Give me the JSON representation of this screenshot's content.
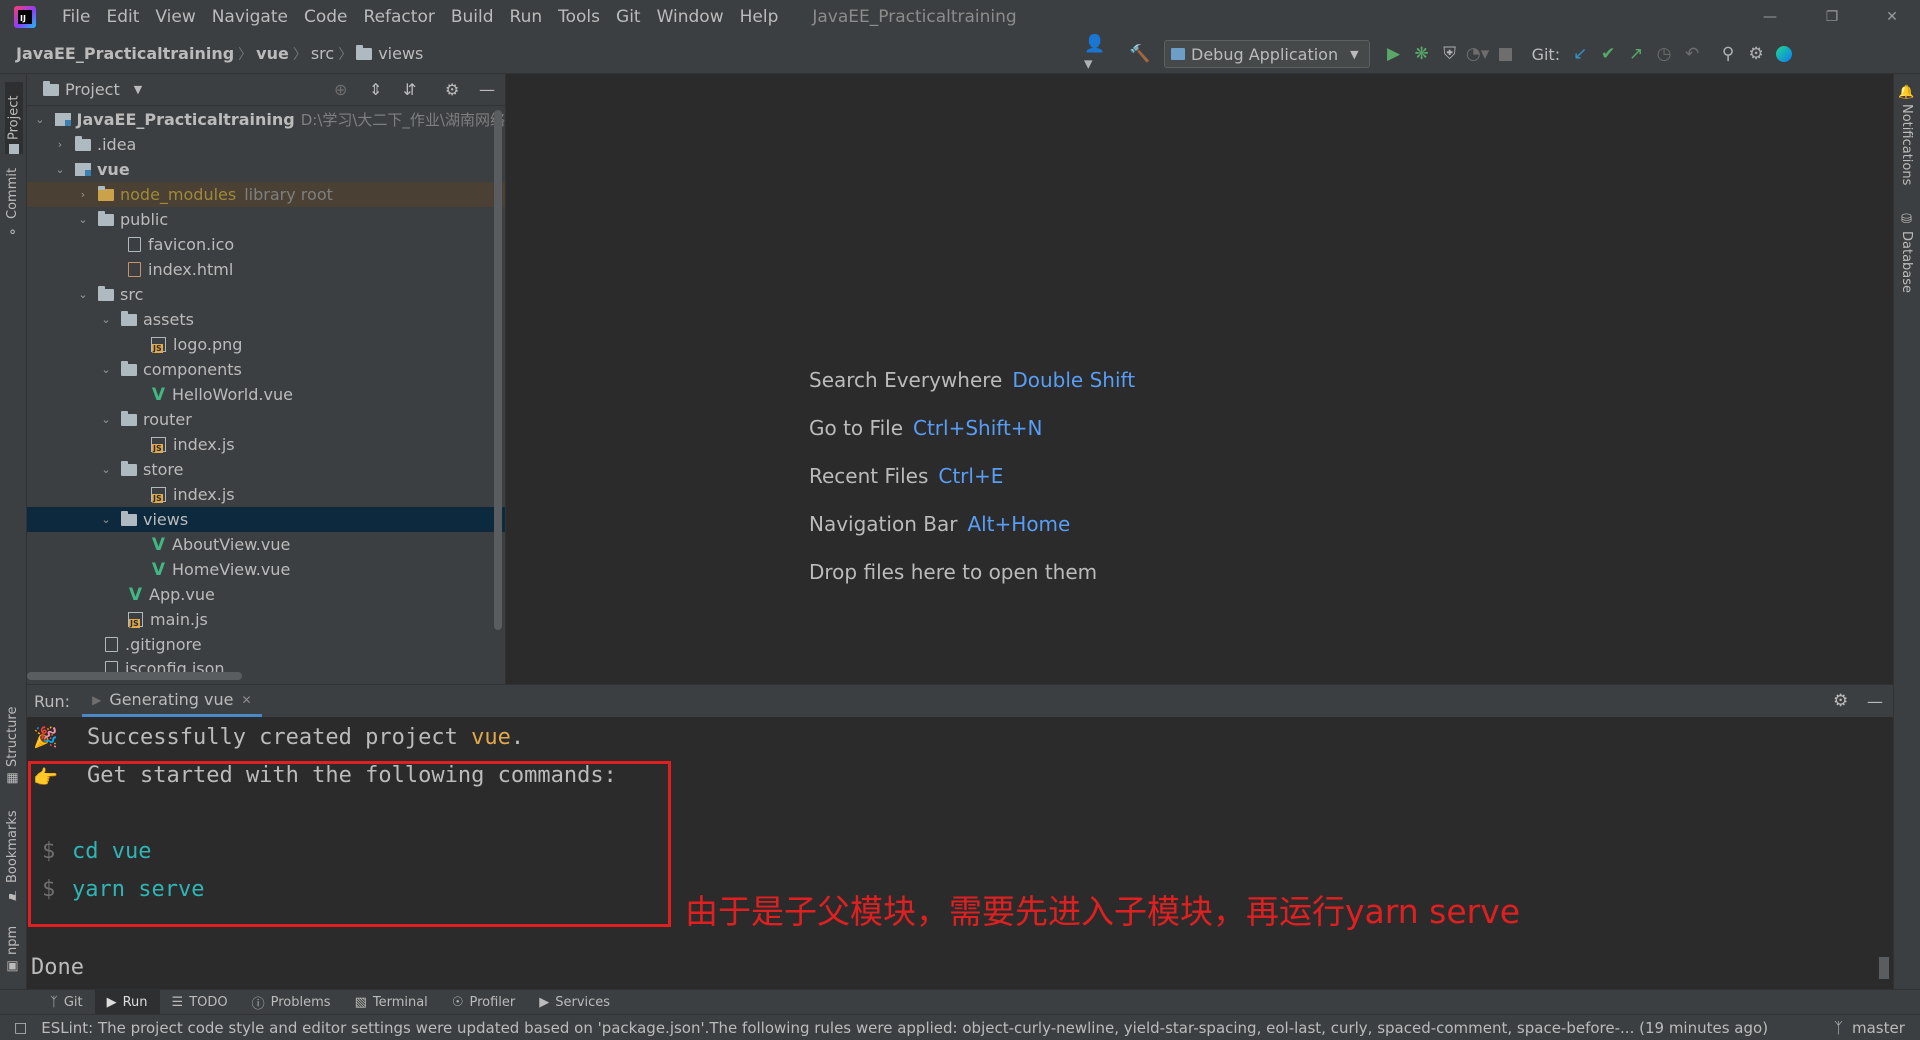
{
  "titlebar": {
    "menus": [
      "File",
      "Edit",
      "View",
      "Navigate",
      "Code",
      "Refactor",
      "Build",
      "Run",
      "Tools",
      "Git",
      "Window",
      "Help"
    ],
    "window_title": "JavaEE_Practicaltraining"
  },
  "navbar": {
    "crumbs": [
      "JavaEE_Practicaltraining",
      "vue",
      "src",
      "views"
    ],
    "run_config": "Debug Application",
    "git_label": "Git:"
  },
  "left_strip": {
    "project": "Project",
    "commit": "Commit",
    "structure": "Structure",
    "bookmarks": "Bookmarks",
    "npm": "npm"
  },
  "right_strip": {
    "notifications": "Notifications",
    "database": "Database"
  },
  "project_panel": {
    "title": "Project",
    "root": {
      "name": "JavaEE_Practicaltraining",
      "path": "D:\\学习\\大二下_作业\\湖南网络"
    },
    "items": [
      {
        "label": ".idea"
      },
      {
        "label": "vue"
      },
      {
        "label": "node_modules",
        "extra": "library root"
      },
      {
        "label": "public"
      },
      {
        "label": "favicon.ico"
      },
      {
        "label": "index.html"
      },
      {
        "label": "src"
      },
      {
        "label": "assets"
      },
      {
        "label": "logo.png"
      },
      {
        "label": "components"
      },
      {
        "label": "HelloWorld.vue"
      },
      {
        "label": "router"
      },
      {
        "label": "index.js"
      },
      {
        "label": "store"
      },
      {
        "label": "index.js"
      },
      {
        "label": "views"
      },
      {
        "label": "AboutView.vue"
      },
      {
        "label": "HomeView.vue"
      },
      {
        "label": "App.vue"
      },
      {
        "label": "main.js"
      },
      {
        "label": ".gitignore"
      },
      {
        "label": "jsconfig.json"
      }
    ]
  },
  "editor_hints": [
    {
      "label": "Search Everywhere",
      "key": "Double Shift"
    },
    {
      "label": "Go to File",
      "key": "Ctrl+Shift+N"
    },
    {
      "label": "Recent Files",
      "key": "Ctrl+E"
    },
    {
      "label": "Navigation Bar",
      "key": "Alt+Home"
    },
    {
      "label": "Drop files here to open them",
      "key": ""
    }
  ],
  "run_panel": {
    "label": "Run:",
    "tab": "Generating vue",
    "line1_prefix": "Successfully created project ",
    "line1_project": "vue",
    "line1_suffix": ".",
    "line2": "Get started with the following commands:",
    "prompt": "$",
    "cmd1": "cd vue",
    "cmd2": "yarn serve",
    "done": "Done",
    "annotation": "由于是子父模块，需要先进入子模块，再运行yarn serve"
  },
  "tool_bar": [
    "Git",
    "Run",
    "TODO",
    "Problems",
    "Terminal",
    "Profiler",
    "Services"
  ],
  "status_bar": {
    "message": "ESLint: The project code style and editor settings were updated based on 'package.json'.The following rules were applied: object-curly-newline, yield-star-spacing, eol-last, curly, spaced-comment, space-before-... (19 minutes ago)",
    "branch": "master"
  },
  "colors": {
    "accent": "#4a88c7",
    "selection": "#0d293e",
    "annotation": "#e02020",
    "key": "#589df6",
    "command": "#2fb5b5"
  }
}
